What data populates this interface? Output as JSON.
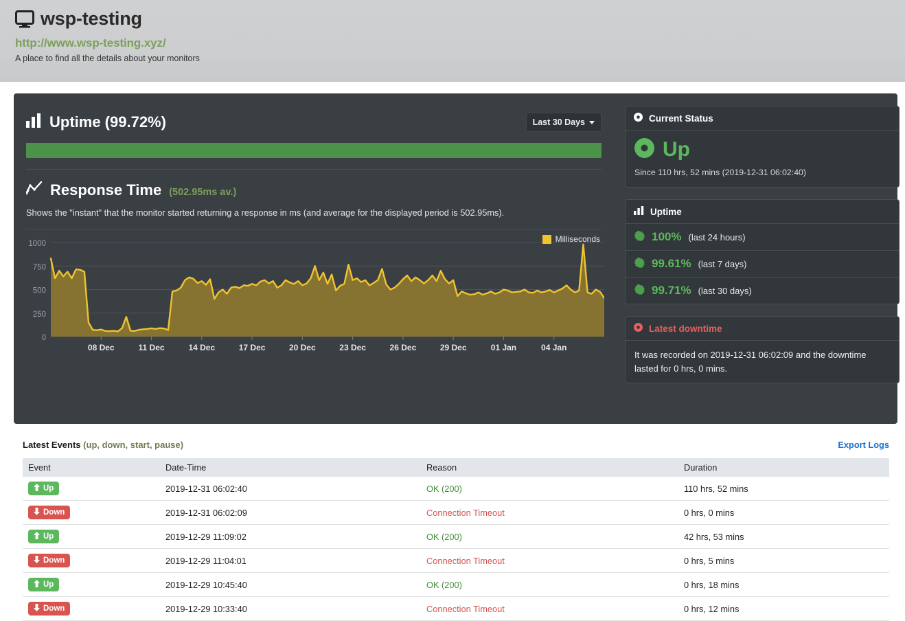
{
  "header": {
    "title": "wsp-testing",
    "icon": "monitor-icon",
    "url": "http://www.wsp-testing.xyz/",
    "subtitle": "A place to find all the details about your monitors"
  },
  "uptime_section": {
    "icon": "bar-chart-icon",
    "title": "Uptime (99.72%)",
    "range_dropdown": "Last 30 Days",
    "bar_color": "#4a9348",
    "bar_percent": 100
  },
  "response_section": {
    "icon": "line-chart-icon",
    "title": "Response Time",
    "average": "(502.95ms av.)",
    "description": "Shows the \"instant\" that the monitor started returning a response in ms (and average for the displayed period is 502.95ms).",
    "legend": "Milliseconds"
  },
  "current_status": {
    "panel_title": "Current Status",
    "panel_icon": "dot-circle-icon",
    "state": "Up",
    "state_icon": "dot-circle-icon",
    "since": "Since 110 hrs, 52 mins (2019-12-31 06:02:40)",
    "color": "#5cb85c"
  },
  "uptime_panel": {
    "panel_title": "Uptime",
    "panel_icon": "bar-chart-icon",
    "rows": [
      {
        "icon": "sunburst-icon",
        "value": "100%",
        "label": "(last 24 hours)"
      },
      {
        "icon": "sunburst-icon",
        "value": "99.61%",
        "label": "(last 7 days)"
      },
      {
        "icon": "sunburst-icon",
        "value": "99.71%",
        "label": "(last 30 days)"
      }
    ]
  },
  "latest_downtime": {
    "panel_title": "Latest downtime",
    "panel_icon": "dot-circle-icon",
    "text": "It was recorded on 2019-12-31 06:02:09 and the downtime lasted for 0 hrs, 0 mins.",
    "color": "#e4615d"
  },
  "events": {
    "title": "Latest Events",
    "title_muted": "(up, down, start, pause)",
    "export_label": "Export Logs",
    "columns": [
      "Event",
      "Date-Time",
      "Reason",
      "Duration"
    ],
    "rows": [
      {
        "event": "Up",
        "event_icon": "arrow-up-icon",
        "datetime": "2019-12-31 06:02:40",
        "reason": "OK (200)",
        "reason_state": "ok",
        "duration": "110 hrs, 52 mins"
      },
      {
        "event": "Down",
        "event_icon": "arrow-down-icon",
        "datetime": "2019-12-31 06:02:09",
        "reason": "Connection Timeout",
        "reason_state": "bad",
        "duration": "0 hrs, 0 mins"
      },
      {
        "event": "Up",
        "event_icon": "arrow-up-icon",
        "datetime": "2019-12-29 11:09:02",
        "reason": "OK (200)",
        "reason_state": "ok",
        "duration": "42 hrs, 53 mins"
      },
      {
        "event": "Down",
        "event_icon": "arrow-down-icon",
        "datetime": "2019-12-29 11:04:01",
        "reason": "Connection Timeout",
        "reason_state": "bad",
        "duration": "0 hrs, 5 mins"
      },
      {
        "event": "Up",
        "event_icon": "arrow-up-icon",
        "datetime": "2019-12-29 10:45:40",
        "reason": "OK (200)",
        "reason_state": "ok",
        "duration": "0 hrs, 18 mins"
      },
      {
        "event": "Down",
        "event_icon": "arrow-down-icon",
        "datetime": "2019-12-29 10:33:40",
        "reason": "Connection Timeout",
        "reason_state": "bad",
        "duration": "0 hrs, 12 mins"
      }
    ]
  },
  "chart_data": {
    "type": "area",
    "title": "Response Time",
    "xlabel": "",
    "ylabel": "Milliseconds",
    "ylim": [
      0,
      1000
    ],
    "yticks": [
      0,
      250,
      500,
      750,
      1000
    ],
    "grid": true,
    "legend": [
      "Milliseconds"
    ],
    "legend_position": "top-right",
    "series_color": "#f0c330",
    "fill_color": "#8a7630",
    "xticks": [
      "08 Dec",
      "11 Dec",
      "14 Dec",
      "17 Dec",
      "20 Dec",
      "23 Dec",
      "26 Dec",
      "29 Dec",
      "01 Jan",
      "04 Jan"
    ],
    "xtick_positions": [
      12,
      24,
      36,
      48,
      60,
      72,
      84,
      96,
      108,
      120
    ],
    "series": [
      {
        "name": "Milliseconds",
        "values": [
          830,
          620,
          700,
          640,
          690,
          620,
          715,
          710,
          690,
          150,
          72,
          68,
          75,
          60,
          58,
          62,
          55,
          90,
          210,
          62,
          60,
          72,
          78,
          82,
          88,
          82,
          90,
          86,
          70,
          480,
          490,
          520,
          600,
          630,
          615,
          570,
          590,
          550,
          610,
          400,
          470,
          500,
          455,
          520,
          530,
          515,
          545,
          540,
          560,
          545,
          585,
          600,
          565,
          590,
          520,
          545,
          600,
          575,
          560,
          590,
          545,
          565,
          620,
          750,
          600,
          680,
          560,
          660,
          490,
          540,
          560,
          765,
          600,
          620,
          580,
          600,
          545,
          570,
          600,
          720,
          555,
          500,
          520,
          560,
          610,
          650,
          590,
          630,
          600,
          565,
          600,
          650,
          590,
          700,
          610,
          565,
          600,
          430,
          480,
          460,
          445,
          450,
          470,
          445,
          460,
          480,
          455,
          470,
          500,
          490,
          470,
          475,
          480,
          500,
          470,
          465,
          490,
          470,
          480,
          495,
          470,
          490,
          510,
          545,
          500,
          470,
          490,
          980,
          470,
          455,
          500,
          475,
          410
        ]
      }
    ]
  }
}
